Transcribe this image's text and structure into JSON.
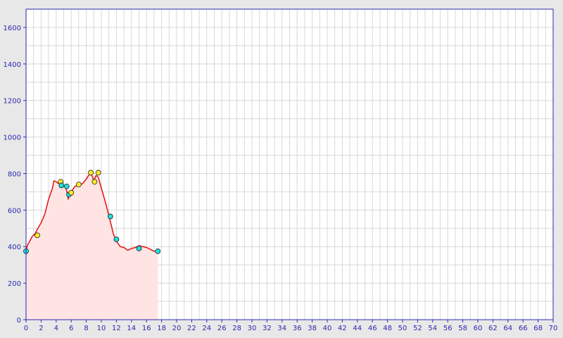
{
  "chart_data": {
    "type": "area",
    "title": "",
    "xlabel": "",
    "ylabel": "",
    "xlim": [
      0,
      70
    ],
    "ylim": [
      0,
      1700
    ],
    "grid": true,
    "x_ticks": [
      0,
      2,
      4,
      6,
      8,
      10,
      12,
      14,
      16,
      18,
      20,
      22,
      24,
      26,
      28,
      30,
      32,
      34,
      36,
      38,
      40,
      42,
      44,
      46,
      48,
      50,
      52,
      54,
      56,
      58,
      60,
      62,
      64,
      66,
      68,
      70
    ],
    "y_ticks": [
      0,
      200,
      400,
      600,
      800,
      1000,
      1200,
      1400,
      1600
    ],
    "series": [
      {
        "line_color": "#e01010",
        "fill_color": "#ffe4e4",
        "x": [
          0,
          0.2,
          0.5,
          0.8,
          1.2,
          1.5,
          2.0,
          2.5,
          3.0,
          3.5,
          3.7,
          4.0,
          4.3,
          4.7,
          5.0,
          5.3,
          5.5,
          5.6,
          5.8,
          6.0,
          6.5,
          7.0,
          7.5,
          8.0,
          8.3,
          8.6,
          8.8,
          9.0,
          9.3,
          9.6,
          10.0,
          10.5,
          11.0,
          11.3,
          11.6,
          12.0,
          12.5,
          13.0,
          13.5,
          14.0,
          14.5,
          15.0,
          15.5,
          16.0,
          16.5,
          17.0,
          17.5
        ],
        "y": [
          375,
          410,
          430,
          455,
          470,
          495,
          530,
          580,
          660,
          720,
          760,
          755,
          745,
          750,
          735,
          720,
          690,
          660,
          690,
          700,
          730,
          735,
          745,
          770,
          790,
          800,
          785,
          760,
          790,
          780,
          720,
          650,
          570,
          520,
          470,
          430,
          400,
          395,
          380,
          390,
          395,
          405,
          400,
          395,
          385,
          375,
          370
        ]
      }
    ],
    "markers": [
      {
        "x": 0.0,
        "y": 375,
        "color": "#22dddd"
      },
      {
        "x": 1.5,
        "y": 462,
        "color": "#ffee22"
      },
      {
        "x": 4.6,
        "y": 755,
        "color": "#ffee22"
      },
      {
        "x": 4.7,
        "y": 735,
        "color": "#22dddd"
      },
      {
        "x": 5.4,
        "y": 730,
        "color": "#22dddd"
      },
      {
        "x": 5.7,
        "y": 685,
        "color": "#22dddd"
      },
      {
        "x": 6.0,
        "y": 695,
        "color": "#ffee22"
      },
      {
        "x": 7.0,
        "y": 740,
        "color": "#ffee22"
      },
      {
        "x": 8.6,
        "y": 805,
        "color": "#ffee22"
      },
      {
        "x": 9.1,
        "y": 755,
        "color": "#ffee22"
      },
      {
        "x": 9.6,
        "y": 805,
        "color": "#ffee22"
      },
      {
        "x": 11.2,
        "y": 565,
        "color": "#22dddd"
      },
      {
        "x": 12.0,
        "y": 440,
        "color": "#22dddd"
      },
      {
        "x": 15.0,
        "y": 390,
        "color": "#22dddd"
      },
      {
        "x": 17.5,
        "y": 375,
        "color": "#22dddd"
      }
    ],
    "colors": {
      "plot_background": "#ffffff",
      "page_background": "#e8e8e8",
      "grid": "#d8d8d8",
      "axis": "#2a2ab0"
    }
  }
}
